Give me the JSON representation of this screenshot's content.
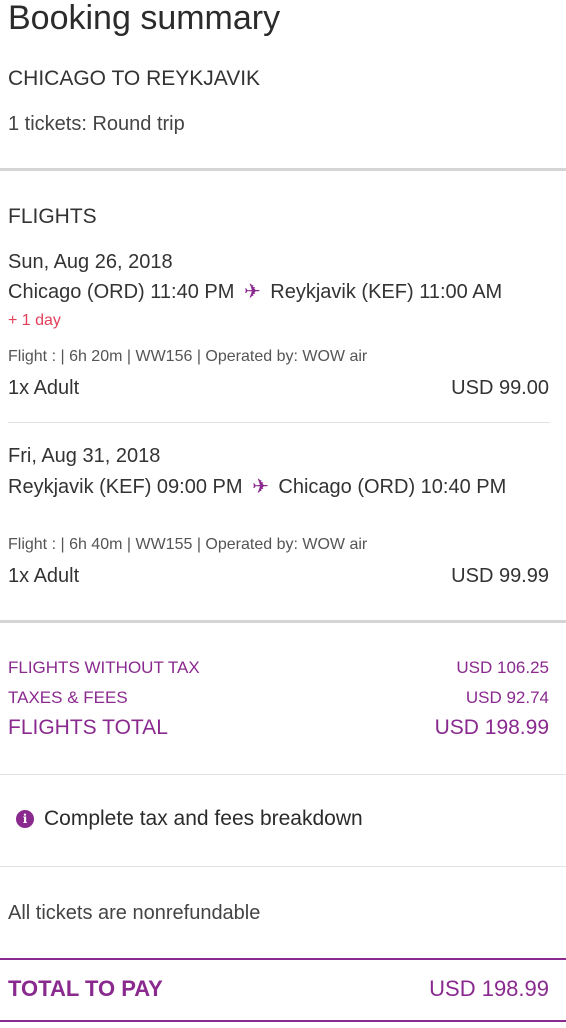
{
  "header": {
    "title": "Booking summary",
    "route": "CHICAGO TO REYKJAVIK",
    "tickets": "1 tickets: Round trip"
  },
  "flights": {
    "heading": "FLIGHTS",
    "outbound": {
      "date": "Sun, Aug 26, 2018",
      "from": "Chicago (ORD) 11:40 PM",
      "to": "Reykjavik (KEF) 11:00 AM",
      "plus_day": "+ 1 day",
      "details": "Flight : | 6h 20m | WW156 | Operated by: WOW air",
      "passenger": "1x Adult",
      "price": "USD 99.00"
    },
    "inbound": {
      "date": "Fri, Aug 31, 2018",
      "from": "Reykjavik (KEF) 09:00 PM",
      "to": "Chicago (ORD) 10:40 PM",
      "details": "Flight : | 6h 40m | WW155 | Operated by: WOW air",
      "passenger": "1x Adult",
      "price": "USD 99.99"
    }
  },
  "summary": {
    "without_tax_label": "FLIGHTS WITHOUT TAX",
    "without_tax_value": "USD 106.25",
    "taxes_label": "TAXES & FEES",
    "taxes_value": "USD 92.74",
    "total_label": "FLIGHTS TOTAL",
    "total_value": "USD 198.99"
  },
  "breakdown": {
    "icon_glyph": "i",
    "label": "Complete tax and fees breakdown"
  },
  "nonrefundable": "All tickets are nonrefundable",
  "total_to_pay": {
    "label": "TOTAL TO PAY",
    "value": "USD 198.99"
  },
  "icons": {
    "plane": "✈"
  },
  "colors": {
    "accent": "#8a2a8f",
    "plus_day": "#e2405a"
  }
}
